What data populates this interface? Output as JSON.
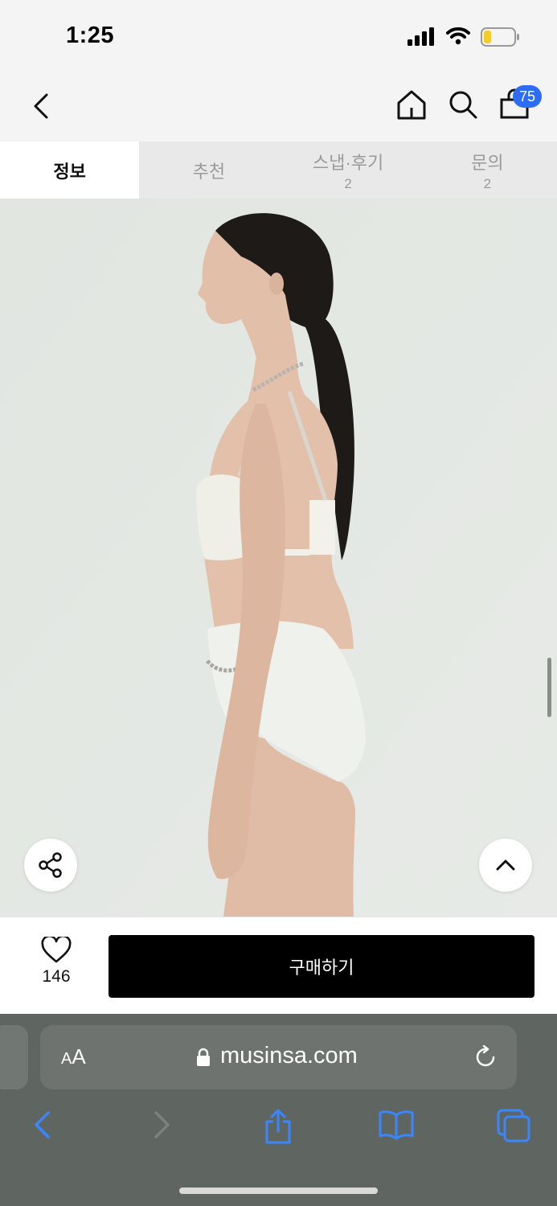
{
  "status_bar": {
    "time": "1:25"
  },
  "top_nav": {
    "back_icon": "chevron-left-icon",
    "home_icon": "home-icon",
    "search_icon": "search-icon",
    "cart_icon": "shopping-bag-icon",
    "cart_count": "75"
  },
  "tabs": [
    {
      "label": "정보",
      "count": "",
      "active": true
    },
    {
      "label": "추천",
      "count": "",
      "active": false
    },
    {
      "label": "스냅·후기",
      "count": "2",
      "active": false
    },
    {
      "label": "문의",
      "count": "2",
      "active": false
    }
  ],
  "product_image": {
    "subject": "model wearing white bikini, side profile",
    "share_icon": "share-icon",
    "scroll_top_icon": "chevron-up-icon"
  },
  "purchase_bar": {
    "like_count": "146",
    "buy_label": "구매하기"
  },
  "browser": {
    "text_size_label_small": "A",
    "text_size_label_large": "A",
    "url": "musinsa.com",
    "toolbar_icons": [
      "back-icon",
      "forward-icon",
      "share-icon",
      "bookmarks-icon",
      "tabs-icon"
    ]
  },
  "colors": {
    "accent_badge": "#2d6cf5",
    "safari_blue": "#3a86ff",
    "buy_button": "#000000"
  }
}
